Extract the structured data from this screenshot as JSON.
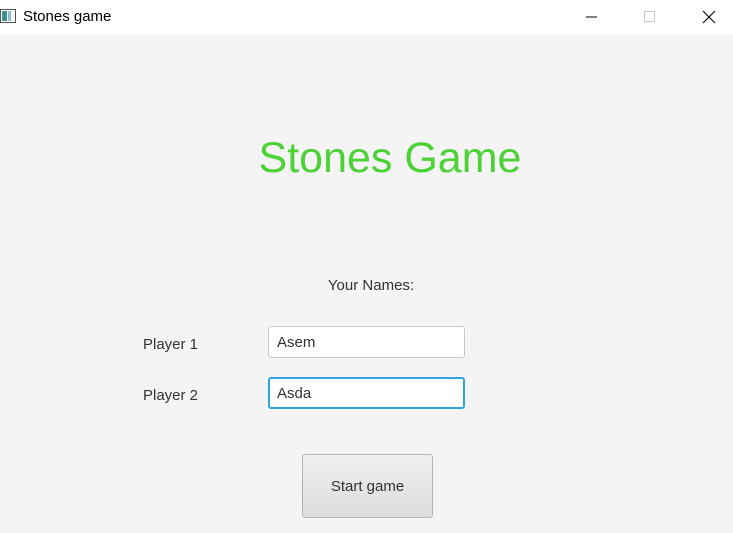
{
  "window": {
    "title": "Stones game",
    "icons": {
      "app": "app-window-icon",
      "minimize": "minimize-icon",
      "maximize": "maximize-icon",
      "close": "close-icon"
    }
  },
  "main": {
    "heading": "Stones Game",
    "heading_color": "#4cd137",
    "names_label": "Your Names:",
    "player1": {
      "label": "Player 1",
      "value": "Asem"
    },
    "player2": {
      "label": "Player 2",
      "value": "Asda",
      "focused": true,
      "focus_color": "#2ea5d9"
    },
    "start_button_label": "Start game"
  }
}
